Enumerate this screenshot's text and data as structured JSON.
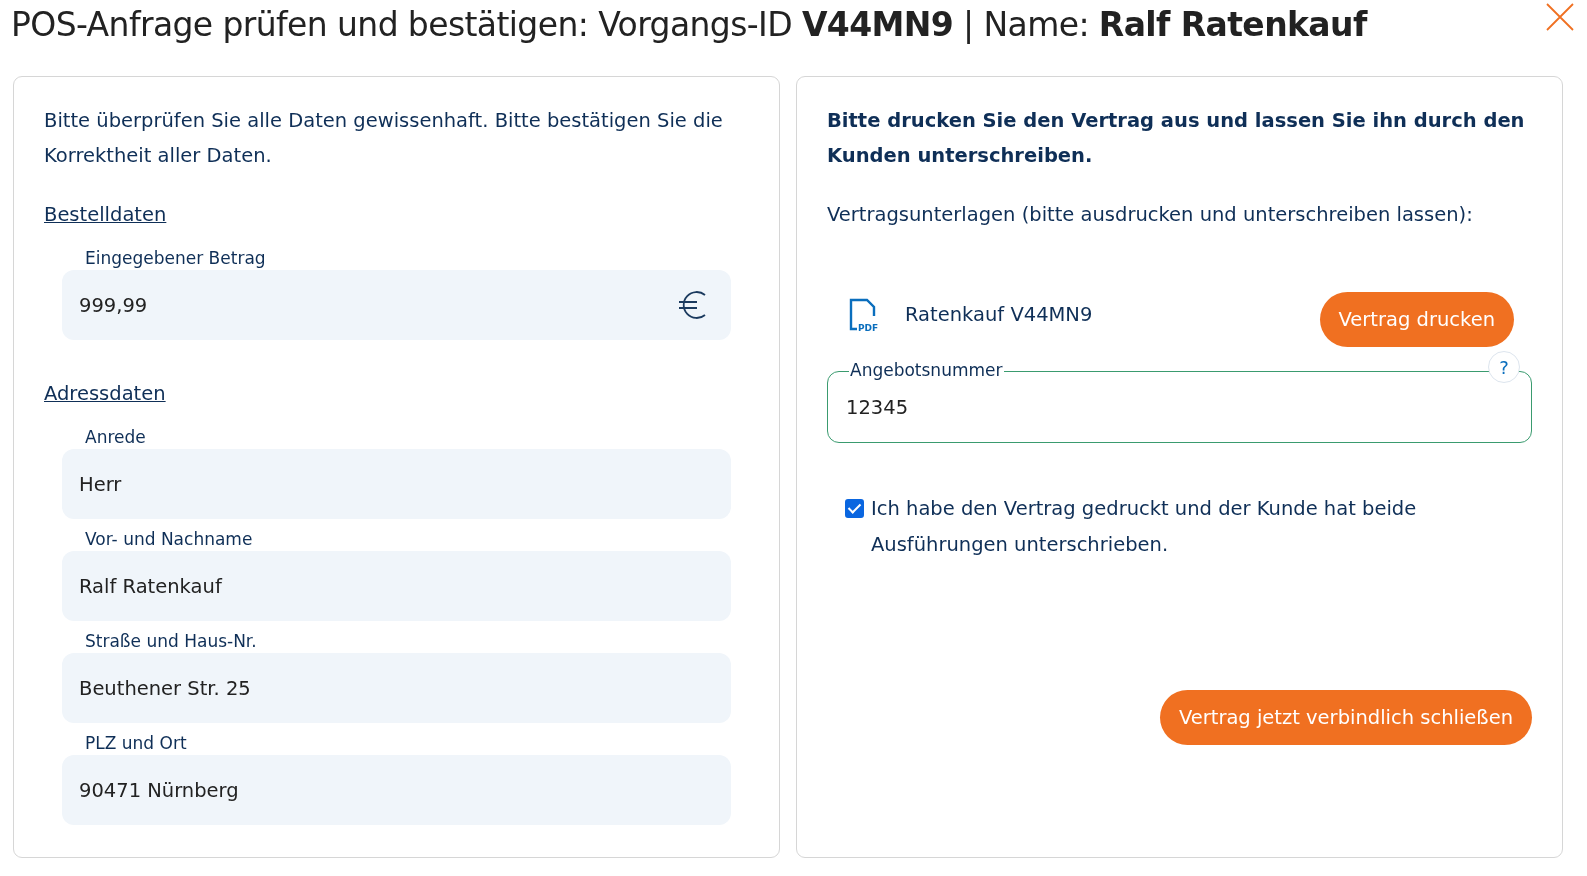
{
  "dialog": {
    "title": "POS-Anfrage prüfen und bestätigen: Vorgangs-ID **V44MN9** | Name: **Ralf Ratenkauf**"
  },
  "left_panel": {
    "intro": "Bitte überprüfen Sie alle Daten gewissenhaft. Bitte bestätigen Sie die Korrektheit aller Daten.",
    "sections": [
      {
        "heading": "Bestelldaten",
        "fields": [
          {
            "label": "Eingegebener Betrag",
            "value": "999,99",
            "kind": "currency"
          }
        ]
      },
      {
        "heading": "Adressdaten",
        "fields": [
          {
            "label": "Anrede",
            "value": "Herr",
            "kind": "text"
          },
          {
            "label": "Vor- und Nachname",
            "value": "Ralf Ratenkauf",
            "kind": "text"
          },
          {
            "label": "Straße und Haus-Nr.",
            "value": "Beuthener Str. 25",
            "kind": "text"
          },
          {
            "label": "PLZ und Ort",
            "value": "90471 Nürnberg",
            "kind": "text"
          }
        ]
      }
    ]
  },
  "right_panel": {
    "instruction": "Bitte drucken Sie den Vertrag aus und lassen Sie ihn durch den Kunden unterschreiben.",
    "documents_label": "Vertragsunterlagen (bitte ausdrucken und unterschreiben lassen):",
    "document": {
      "icon_text": "PDF",
      "name": "Ratenkauf V44MN9",
      "print_button": "Vertrag drucken"
    },
    "offer_field": {
      "label": "Angebotsnummer",
      "value": "12345",
      "help": "?"
    },
    "confirm": {
      "label": "Ich habe den Vertrag gedruckt und der Kunde hat beide Ausführungen unterschrieben.",
      "checked": true
    },
    "submit_button": "Vertrag jetzt verbindlich schließen"
  }
}
